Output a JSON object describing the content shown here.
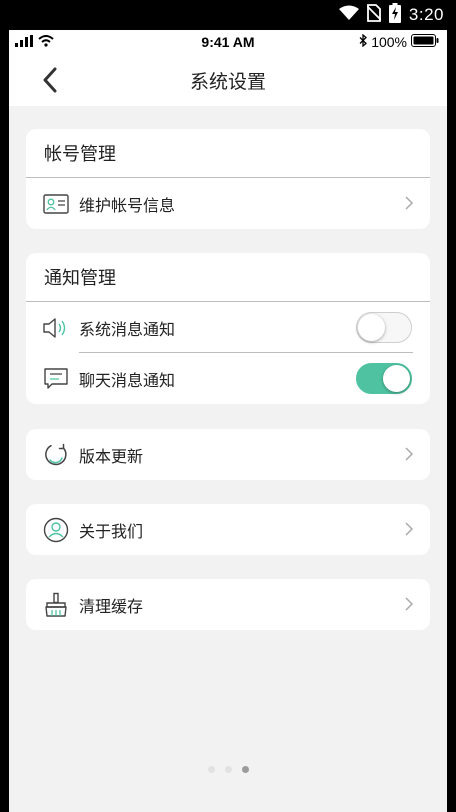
{
  "android_status": {
    "time": "3:20"
  },
  "ios_status": {
    "time": "9:41 AM",
    "battery": "100%"
  },
  "nav": {
    "title": "系统设置"
  },
  "account": {
    "heading": "帐号管理",
    "items": [
      {
        "label": "维护帐号信息",
        "icon": "id-card-icon"
      }
    ]
  },
  "notify": {
    "heading": "通知管理",
    "items": [
      {
        "label": "系统消息通知",
        "icon": "speaker-icon",
        "enabled": false
      },
      {
        "label": "聊天消息通知",
        "icon": "chat-icon",
        "enabled": true
      }
    ]
  },
  "menu": {
    "update": {
      "label": "版本更新",
      "icon": "refresh-icon"
    },
    "about": {
      "label": "关于我们",
      "icon": "user-icon"
    },
    "cache": {
      "label": "清理缓存",
      "icon": "broom-icon"
    }
  },
  "pagination": {
    "count": 3,
    "active": 3
  },
  "colors": {
    "accent": "#4fc3a1",
    "background": "#f2f2f2",
    "card": "#ffffff"
  }
}
